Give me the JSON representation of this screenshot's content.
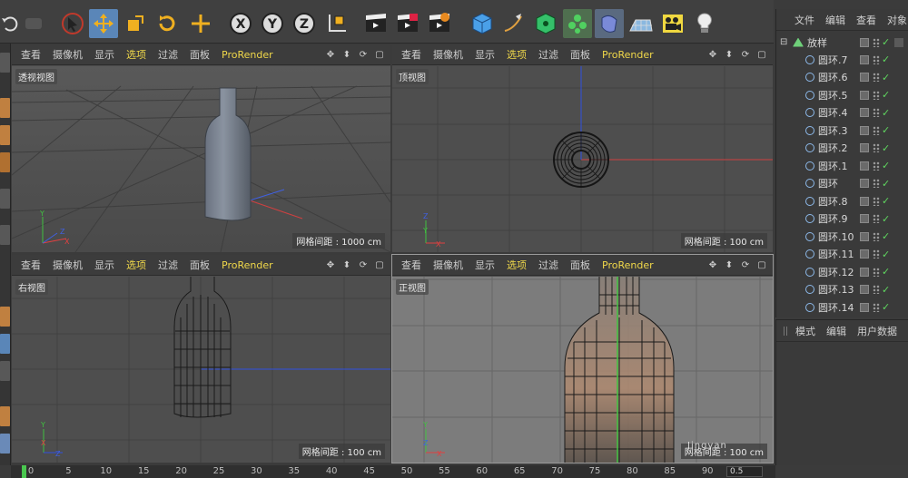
{
  "toolbar": {
    "tools": [
      {
        "name": "undo-icon",
        "active": false
      },
      {
        "name": "redo-icon",
        "active": false
      },
      {
        "name": "live-selection-icon",
        "active": false
      },
      {
        "name": "move-icon",
        "active": true
      },
      {
        "name": "scale-icon",
        "active": false
      },
      {
        "name": "rotate-icon",
        "active": false
      },
      {
        "name": "recent-tool-icon",
        "active": false
      },
      {
        "name": "x-axis-lock-icon",
        "label": "X"
      },
      {
        "name": "y-axis-lock-icon",
        "label": "Y"
      },
      {
        "name": "z-axis-lock-icon",
        "label": "Z"
      },
      {
        "name": "coordinate-system-icon"
      },
      {
        "name": "render-view-icon"
      },
      {
        "name": "render-picture-viewer-icon"
      },
      {
        "name": "render-settings-icon"
      },
      {
        "name": "cube-icon"
      },
      {
        "name": "pen-spline-icon"
      },
      {
        "name": "subdivision-surface-icon"
      },
      {
        "name": "cloner-icon"
      },
      {
        "name": "deformer-icon"
      },
      {
        "name": "floor-icon"
      },
      {
        "name": "camera-icon"
      },
      {
        "name": "light-icon"
      }
    ]
  },
  "viewports": {
    "menu": [
      "查看",
      "摄像机",
      "显示",
      "选项",
      "过滤",
      "面板",
      "ProRender"
    ],
    "highlight_index": 3,
    "perspective": {
      "title": "透视视图",
      "grid": "网格间距 : 1000 cm"
    },
    "top": {
      "title": "顶视图",
      "grid": "网格间距 : 100 cm"
    },
    "right": {
      "title": "右视图",
      "grid": "网格间距 : 100 cm"
    },
    "front": {
      "title": "正视图",
      "grid": "网格间距 : 100 cm"
    }
  },
  "object_manager": {
    "menu": [
      "文件",
      "编辑",
      "查看",
      "对象"
    ],
    "root": "放样",
    "items": [
      "圆环.7",
      "圆环.6",
      "圆环.5",
      "圆环.4",
      "圆环.3",
      "圆环.2",
      "圆环.1",
      "圆环",
      "圆环.8",
      "圆环.9",
      "圆环.10",
      "圆环.11",
      "圆环.12",
      "圆环.13",
      "圆环.14"
    ]
  },
  "attribute_manager": {
    "menu": [
      "模式",
      "编辑",
      "用户数据"
    ]
  },
  "timeline": {
    "ticks": [
      "0",
      "5",
      "10",
      "15",
      "20",
      "25",
      "30",
      "35",
      "40",
      "45",
      "50",
      "55",
      "60",
      "65",
      "70",
      "75",
      "80",
      "85",
      "90"
    ],
    "frame_field": "0.5"
  },
  "watermark": "Jingyan",
  "colors": {
    "accent_selected": "#5a86b8",
    "menu_highlight": "#f0d84a",
    "x_axis": "#e04040",
    "y_axis": "#40c040",
    "z_axis": "#4060e0",
    "playhead": "#49c74f"
  }
}
